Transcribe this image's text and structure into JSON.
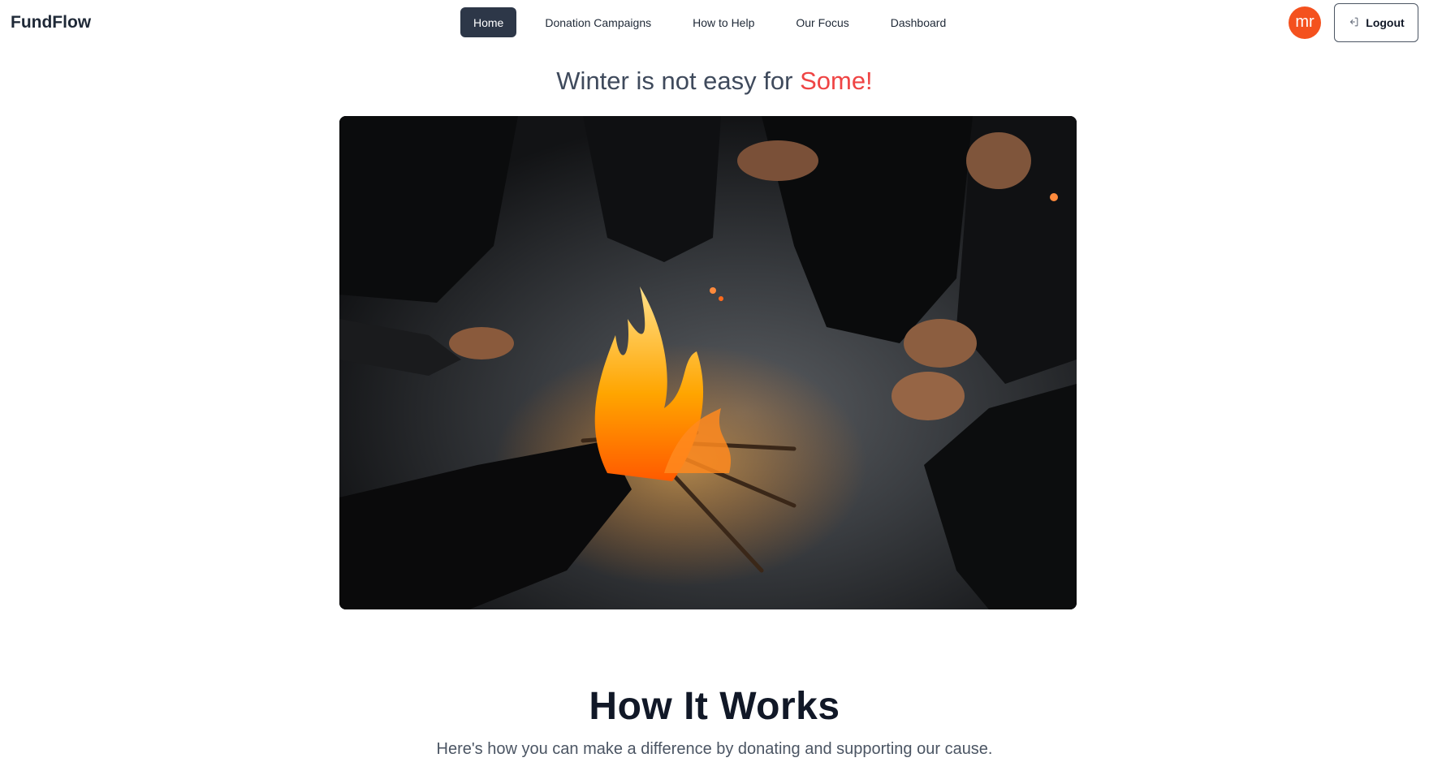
{
  "nav": {
    "brand": "FundFlow",
    "links": [
      {
        "label": "Home",
        "active": true
      },
      {
        "label": "Donation Campaigns",
        "active": false
      },
      {
        "label": "How to Help",
        "active": false
      },
      {
        "label": "Our Focus",
        "active": false
      },
      {
        "label": "Dashboard",
        "active": false
      }
    ],
    "avatar_initials": "mr",
    "avatar_color": "#f4511e",
    "logout_label": "Logout"
  },
  "hero": {
    "title_main": "Winter is not easy for ",
    "title_accent": "Some!",
    "accent_color": "#ef4444",
    "image_subject": "people warming hands over campfire"
  },
  "how_it_works": {
    "title": "How It Works",
    "subtitle": "Here's how you can make a difference by donating and supporting our cause."
  }
}
